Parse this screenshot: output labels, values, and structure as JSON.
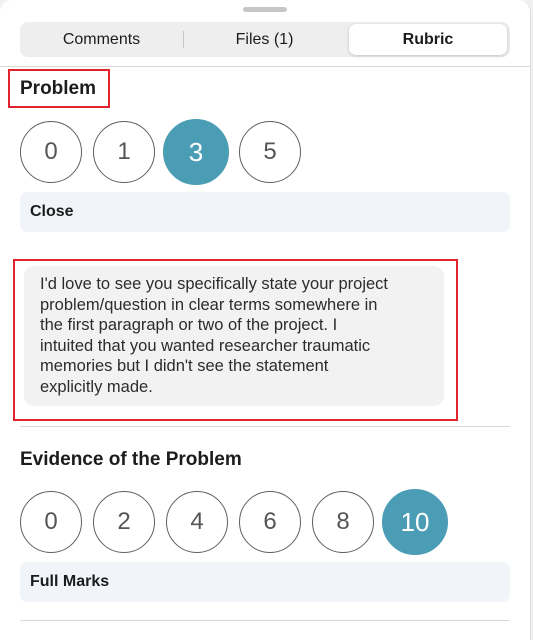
{
  "tabs": [
    {
      "label": "Comments",
      "selected": false
    },
    {
      "label": "Files (1)",
      "selected": false
    },
    {
      "label": "Rubric",
      "selected": true
    }
  ],
  "colors": {
    "accent": "#4a9db5",
    "highlight": "#e0242d",
    "level_background": "#f1f5f9",
    "comment_background": "#f2f2f2"
  },
  "criteria": [
    {
      "title": "Problem",
      "scores": [
        "0",
        "1",
        "3",
        "5"
      ],
      "selected_score": "3",
      "level_label": "Close",
      "comment": "I'd love to see you specifically state your project\nproblem/question in clear terms somewhere in\nthe first paragraph or two of the project. I\nintuited that you wanted researcher traumatic\nmemories but I didn't see the statement\nexplicitly made."
    },
    {
      "title": "Evidence of the Problem",
      "scores": [
        "0",
        "2",
        "4",
        "6",
        "8",
        "10"
      ],
      "selected_score": "10",
      "level_label": "Full Marks"
    }
  ]
}
